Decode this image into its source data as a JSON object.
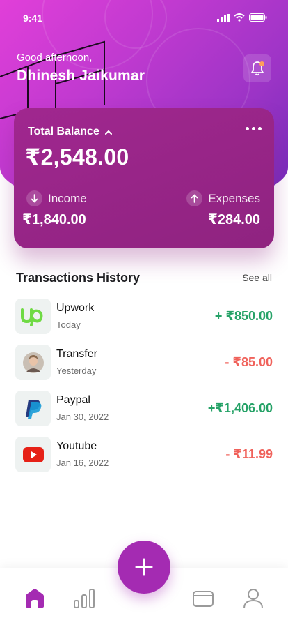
{
  "status_bar": {
    "time": "9:41"
  },
  "header": {
    "greeting": "Good afternoon,",
    "user_name": "Dhinesh Jaikumar"
  },
  "balance_card": {
    "title": "Total Balance",
    "amount": "₹2,548.00",
    "income_label": "Income",
    "income_value": "₹1,840.00",
    "expenses_label": "Expenses",
    "expenses_value": "₹284.00"
  },
  "transactions": {
    "title": "Transactions History",
    "see_all": "See all",
    "items": [
      {
        "name": "Upwork",
        "date": "Today",
        "amount": "+ ₹850.00",
        "type": "credit",
        "icon": "upwork-logo"
      },
      {
        "name": "Transfer",
        "date": "Yesterday",
        "amount": "- ₹85.00",
        "type": "debit",
        "icon": "person-avatar"
      },
      {
        "name": "Paypal",
        "date": "Jan 30, 2022",
        "amount": "+₹1,406.00",
        "type": "credit",
        "icon": "paypal-logo"
      },
      {
        "name": "Youtube",
        "date": "Jan 16, 2022",
        "amount": "- ₹11.99",
        "type": "debit",
        "icon": "youtube-logo"
      }
    ]
  },
  "colors": {
    "accent": "#a42bb2",
    "card": "#9b2589",
    "credit": "#25a267",
    "debit": "#f0625b"
  },
  "tabbar": {
    "items": [
      "home-icon",
      "stats-icon",
      "add-icon",
      "wallet-icon",
      "profile-icon"
    ],
    "active": "home-icon"
  }
}
